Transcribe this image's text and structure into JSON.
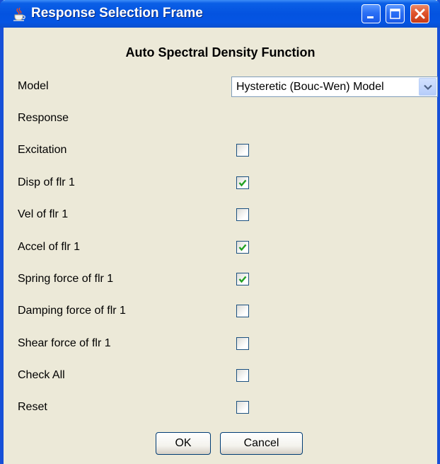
{
  "window": {
    "title": "Response Selection Frame",
    "icon": "java-cup-icon",
    "controls": [
      "minimize-icon",
      "maximize-icon",
      "close-icon"
    ]
  },
  "heading": "Auto Spectral Density Function",
  "model": {
    "label": "Model",
    "selected": "Hysteretic (Bouc-Wen) Model"
  },
  "response_label": "Response",
  "options": [
    {
      "label": "Excitation",
      "checked": false
    },
    {
      "label": "Disp of flr 1",
      "checked": true
    },
    {
      "label": "Vel of flr 1",
      "checked": false
    },
    {
      "label": "Accel of flr 1",
      "checked": true
    },
    {
      "label": "Spring force of flr 1",
      "checked": true
    },
    {
      "label": "Damping force of flr 1",
      "checked": false
    },
    {
      "label": "Shear force of flr 1",
      "checked": false
    },
    {
      "label": "Check All",
      "checked": false
    },
    {
      "label": "Reset",
      "checked": false
    }
  ],
  "buttons": {
    "ok": "OK",
    "cancel": "Cancel"
  },
  "colors": {
    "titlebar": "#0453e0",
    "checkmark": "#21a121",
    "checkbox_border": "#1c5180",
    "window_bg": "#ece9d8"
  }
}
